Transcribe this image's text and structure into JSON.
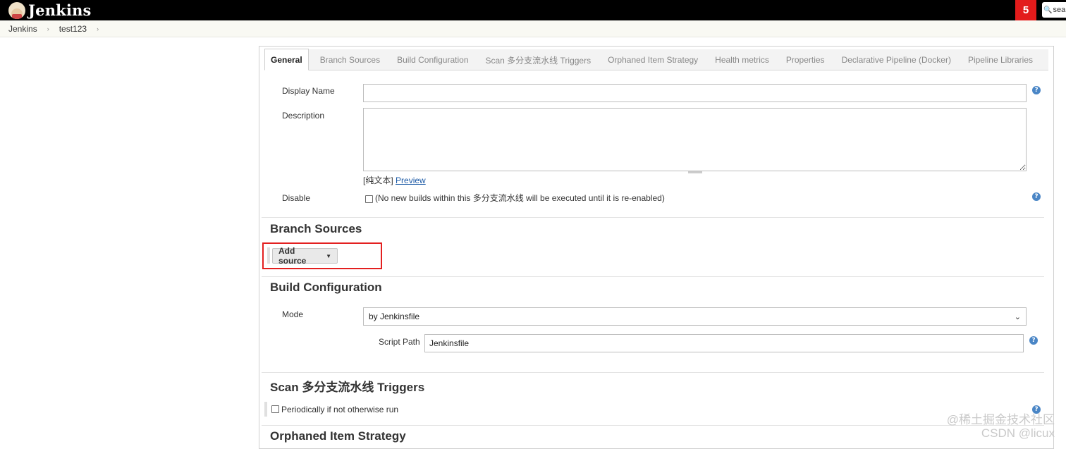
{
  "header": {
    "app_title": "Jenkins",
    "notification_count": "5",
    "search_placeholder": "sea"
  },
  "breadcrumb": [
    {
      "label": "Jenkins"
    },
    {
      "label": "test123"
    }
  ],
  "tabs": [
    {
      "label": "General",
      "active": true
    },
    {
      "label": "Branch Sources"
    },
    {
      "label": "Build Configuration"
    },
    {
      "label": "Scan 多分支流水线 Triggers"
    },
    {
      "label": "Orphaned Item Strategy"
    },
    {
      "label": "Health metrics"
    },
    {
      "label": "Properties"
    },
    {
      "label": "Declarative Pipeline (Docker)"
    },
    {
      "label": "Pipeline Libraries"
    }
  ],
  "general": {
    "display_name_label": "Display Name",
    "display_name_value": "",
    "description_label": "Description",
    "description_value": "",
    "format_text": "[纯文本]",
    "preview_link": "Preview",
    "disable_label": "Disable",
    "disable_checked": false,
    "disable_note": "(No new builds within this 多分支流水线 will be executed until it is re-enabled)"
  },
  "branch_sources": {
    "title": "Branch Sources",
    "add_source_label": "Add source"
  },
  "build_configuration": {
    "title": "Build Configuration",
    "mode_label": "Mode",
    "mode_value": "by Jenkinsfile",
    "script_path_label": "Script Path",
    "script_path_value": "Jenkinsfile"
  },
  "scan_triggers": {
    "title": "Scan 多分支流水线 Triggers",
    "periodic_label": "Periodically if not otherwise run",
    "periodic_checked": false
  },
  "orphaned": {
    "title": "Orphaned Item Strategy"
  },
  "watermark": {
    "line1": "@稀土掘金技术社区",
    "line2": "CSDN @licux"
  },
  "colors": {
    "header_bg": "#000000",
    "badge": "#e31b1b",
    "highlight_box": "#e32020",
    "link": "#1c5aa6"
  }
}
